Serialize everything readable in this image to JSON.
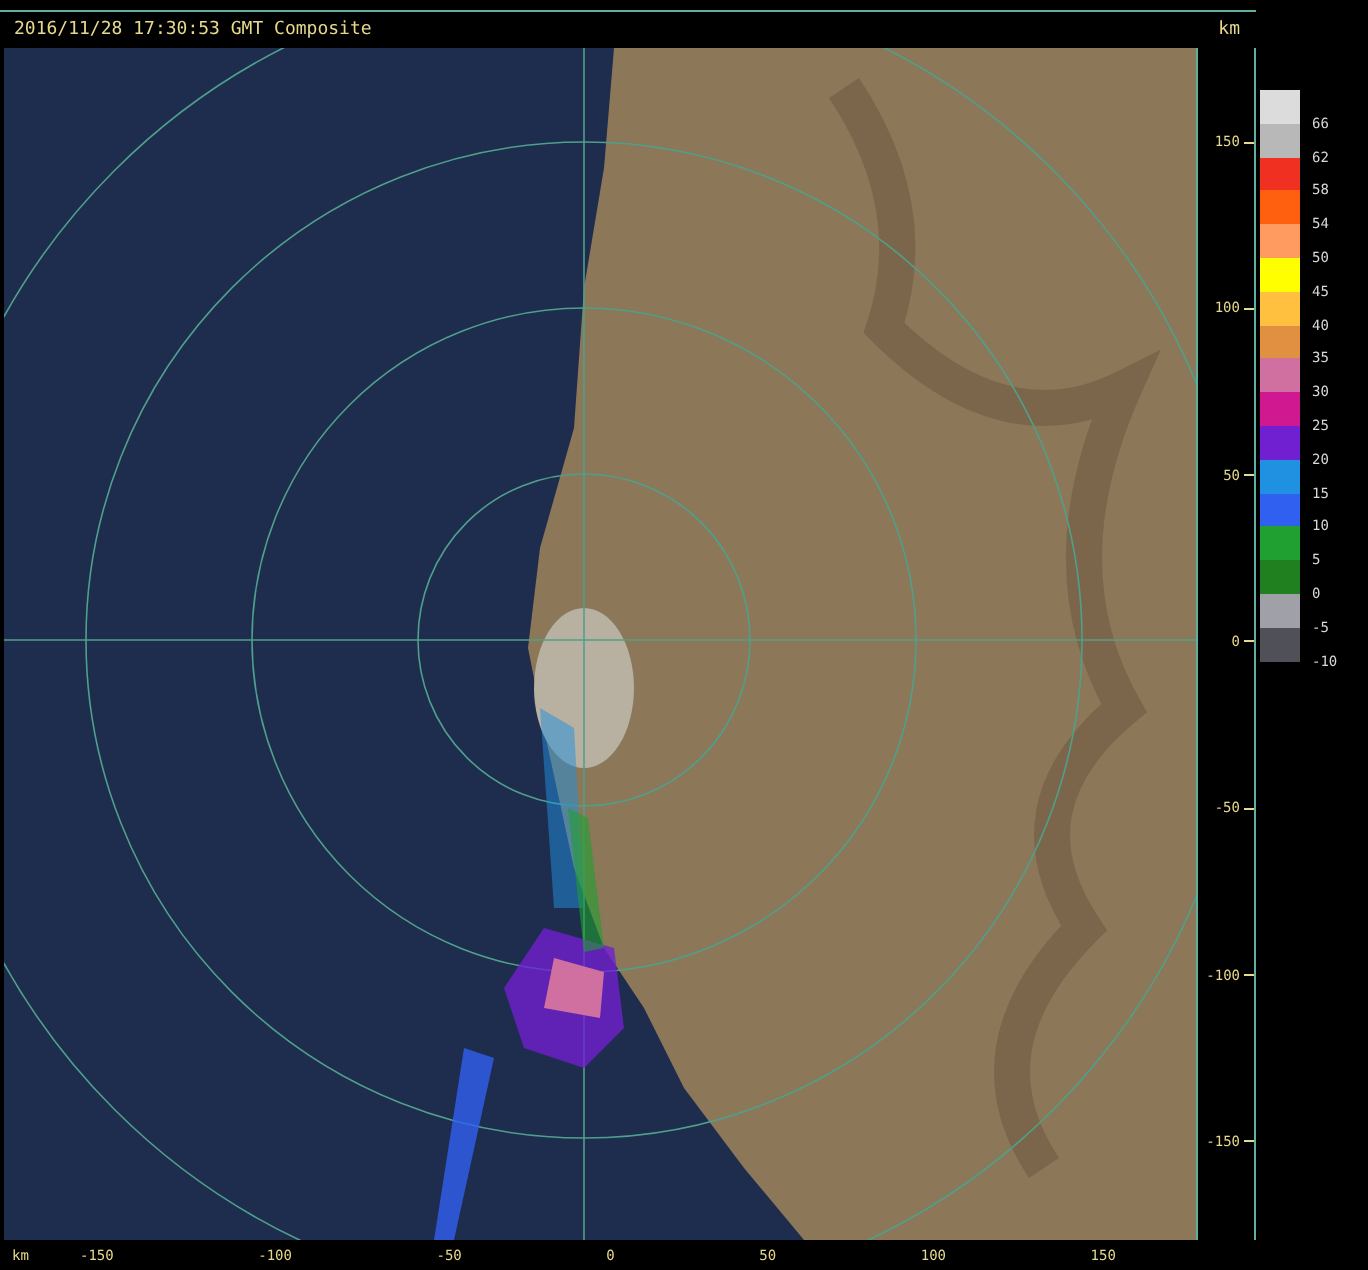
{
  "header": {
    "title": "2016/11/28 17:30:53 GMT Composite",
    "unit": "km"
  },
  "y_axis": {
    "ticks": [
      "150",
      "100",
      "50",
      "0",
      "-50",
      "-100",
      "-150"
    ]
  },
  "x_axis": {
    "unit": "km",
    "ticks": [
      "-150",
      "-100",
      "-50",
      "0",
      "50",
      "100",
      "150"
    ]
  },
  "legend": [
    {
      "label": "66",
      "color": "#dcdcdc"
    },
    {
      "label": "62",
      "color": "#b8b8b8"
    },
    {
      "label": "58",
      "color": "#f03020"
    },
    {
      "label": "54",
      "color": "#ff6010"
    },
    {
      "label": "50",
      "color": "#ff9a60"
    },
    {
      "label": "45",
      "color": "#ffff00"
    },
    {
      "label": "40",
      "color": "#ffc040"
    },
    {
      "label": "35",
      "color": "#e09040"
    },
    {
      "label": "30",
      "color": "#d070a0"
    },
    {
      "label": "25",
      "color": "#d01890"
    },
    {
      "label": "20",
      "color": "#7020d0"
    },
    {
      "label": "15",
      "color": "#2090e0"
    },
    {
      "label": "10",
      "color": "#3060f0"
    },
    {
      "label": "5",
      "color": "#20a030"
    },
    {
      "label": "0",
      "color": "#208020"
    },
    {
      "label": "-5",
      "color": "#a0a0a8"
    },
    {
      "label": "-10",
      "color": "#505058"
    }
  ]
}
